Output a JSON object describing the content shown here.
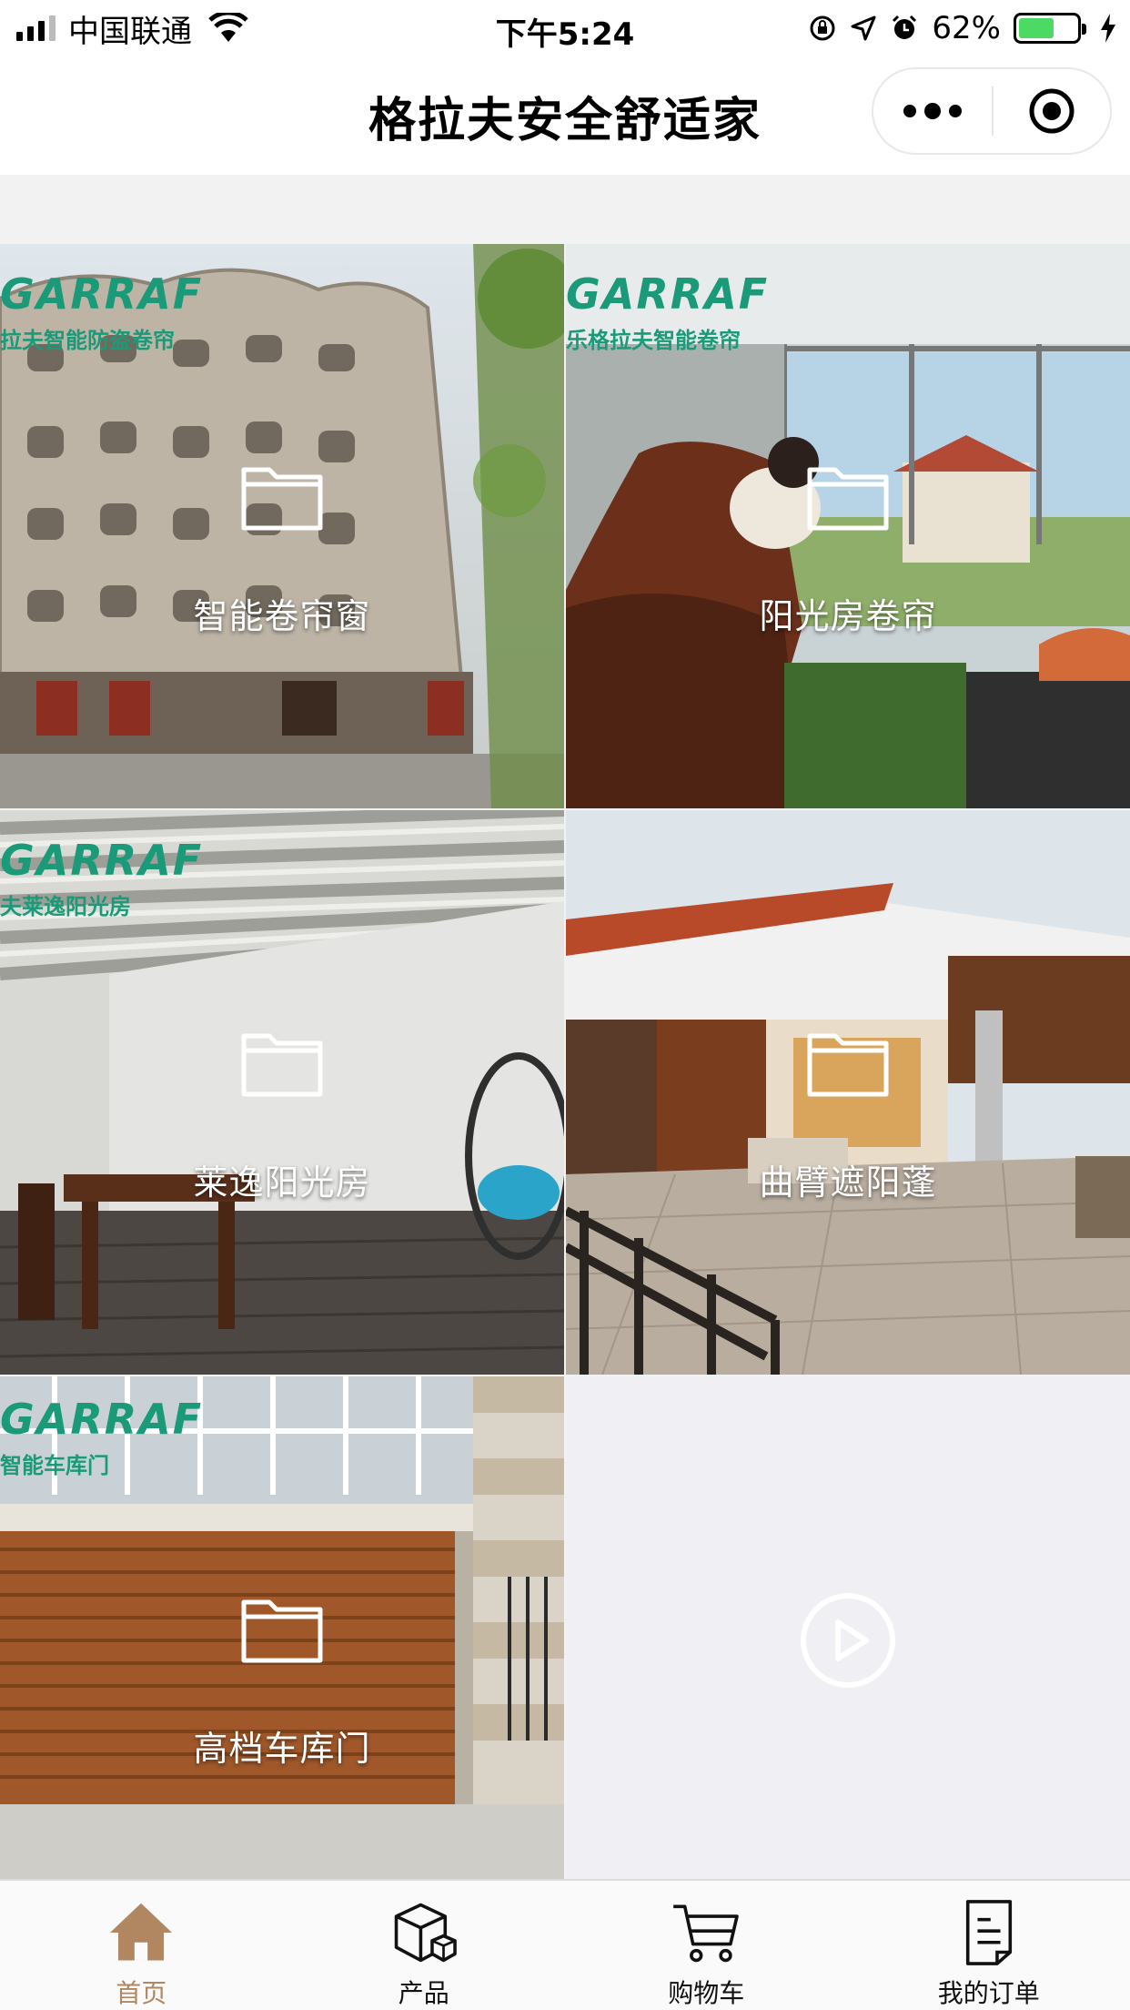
{
  "status_bar": {
    "carrier": "中国联通",
    "time": "下午5:24",
    "battery_percent": "62%",
    "battery_level": 0.62,
    "battery_color": "#4cd964"
  },
  "nav": {
    "title": "格拉夫安全舒适家"
  },
  "tiles": [
    {
      "label": "智能卷帘窗",
      "brand_logo": "GARRAF",
      "brand_sub": "拉夫智能防盗卷帘",
      "icon": "folder-icon"
    },
    {
      "label": "阳光房卷帘",
      "brand_logo": "GARRAF",
      "brand_sub": "乐格拉夫智能卷帘",
      "icon": "folder-icon"
    },
    {
      "label": "莱逸阳光房",
      "brand_logo": "GARRAF",
      "brand_sub": "夫莱逸阳光房",
      "icon": "folder-icon"
    },
    {
      "label": "曲臂遮阳蓬",
      "icon": "folder-icon"
    },
    {
      "label": "高档车库门",
      "brand_logo": "GARRAF",
      "brand_sub": "智能车库门",
      "icon": "folder-icon"
    },
    {
      "icon": "play-icon"
    }
  ],
  "tabs": [
    {
      "label": "首页",
      "icon": "home-icon",
      "active": true
    },
    {
      "label": "产品",
      "icon": "box-icon",
      "active": false
    },
    {
      "label": "购物车",
      "icon": "cart-icon",
      "active": false
    },
    {
      "label": "我的订单",
      "icon": "order-icon",
      "active": false
    }
  ],
  "colors": {
    "brand_green": "#1a9a78",
    "active_tab": "#b08760"
  }
}
